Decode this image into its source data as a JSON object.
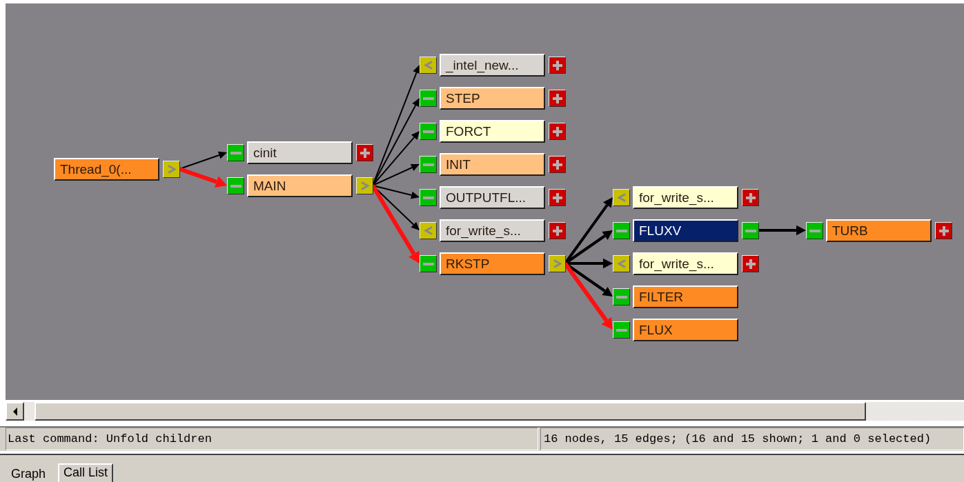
{
  "graph": {
    "root": {
      "label": "Thread_0(...",
      "color": "#fd8a22",
      "selected": false,
      "out_button": {
        "kind": "next"
      },
      "children": [
        {
          "label": "cinit",
          "color": "#d8d5d0",
          "selected": false,
          "in_button": {
            "kind": "fold"
          },
          "out_button": {
            "kind": "expand"
          },
          "edge": {
            "kind": "thin"
          }
        },
        {
          "label": "MAIN",
          "color": "#ffc080",
          "selected": false,
          "in_button": {
            "kind": "fold"
          },
          "out_button": {
            "kind": "next"
          },
          "edge": {
            "kind": "hot"
          },
          "children": [
            {
              "label": "_intel_new...",
              "color": "#d8d5d0",
              "selected": false,
              "in_button": {
                "kind": "caller"
              },
              "out_button": {
                "kind": "expand"
              },
              "edge": {
                "kind": "thin"
              }
            },
            {
              "label": "STEP",
              "color": "#ffc080",
              "selected": false,
              "in_button": {
                "kind": "fold"
              },
              "out_button": {
                "kind": "expand"
              },
              "edge": {
                "kind": "thin"
              }
            },
            {
              "label": "FORCT",
              "color": "#ffffd0",
              "selected": false,
              "in_button": {
                "kind": "fold"
              },
              "out_button": {
                "kind": "expand"
              },
              "edge": {
                "kind": "thin"
              }
            },
            {
              "label": "INIT",
              "color": "#ffc080",
              "selected": false,
              "in_button": {
                "kind": "fold"
              },
              "out_button": {
                "kind": "expand"
              },
              "edge": {
                "kind": "thin"
              }
            },
            {
              "label": "OUTPUTFL...",
              "color": "#d8d5d0",
              "selected": false,
              "in_button": {
                "kind": "fold"
              },
              "out_button": {
                "kind": "expand"
              },
              "edge": {
                "kind": "thin"
              }
            },
            {
              "label": "for_write_s...",
              "color": "#d8d5d0",
              "selected": false,
              "in_button": {
                "kind": "caller"
              },
              "out_button": {
                "kind": "expand"
              },
              "edge": {
                "kind": "thin"
              }
            },
            {
              "label": "RKSTP",
              "color": "#fd8a22",
              "selected": false,
              "in_button": {
                "kind": "fold"
              },
              "out_button": {
                "kind": "next"
              },
              "edge": {
                "kind": "hot"
              },
              "children": [
                {
                  "label": "for_write_s...",
                  "color": "#ffffd0",
                  "selected": false,
                  "in_button": {
                    "kind": "caller"
                  },
                  "out_button": {
                    "kind": "expand"
                  },
                  "edge": {
                    "kind": "heavy"
                  }
                },
                {
                  "label": "FLUXV",
                  "selected": true,
                  "in_button": {
                    "kind": "fold"
                  },
                  "out_button": {
                    "kind": "fold"
                  },
                  "edge": {
                    "kind": "heavy"
                  },
                  "children": [
                    {
                      "label": "TURB",
                      "color": "#fd8a22",
                      "selected": false,
                      "in_button": {
                        "kind": "fold"
                      },
                      "out_button": {
                        "kind": "expand"
                      },
                      "edge": {
                        "kind": "heavy"
                      }
                    }
                  ]
                },
                {
                  "label": "for_write_s...",
                  "color": "#ffffd0",
                  "selected": false,
                  "in_button": {
                    "kind": "caller"
                  },
                  "out_button": {
                    "kind": "expand"
                  },
                  "edge": {
                    "kind": "heavy"
                  }
                },
                {
                  "label": "FILTER",
                  "color": "#fd8a22",
                  "selected": false,
                  "in_button": {
                    "kind": "fold"
                  },
                  "edge": {
                    "kind": "heavy"
                  }
                },
                {
                  "label": "FLUX",
                  "color": "#fd8a22",
                  "selected": false,
                  "in_button": {
                    "kind": "fold"
                  },
                  "edge": {
                    "kind": "hot"
                  }
                }
              ]
            }
          ]
        }
      ]
    }
  },
  "status_bar": {
    "message": "Last command: Unfold children",
    "summary": "16 nodes, 15 edges; (16 and 15 shown; 1 and 0 selected)"
  },
  "tabs": [
    {
      "label": "Graph",
      "selected": true
    },
    {
      "label": "Call List",
      "selected": false
    }
  ]
}
